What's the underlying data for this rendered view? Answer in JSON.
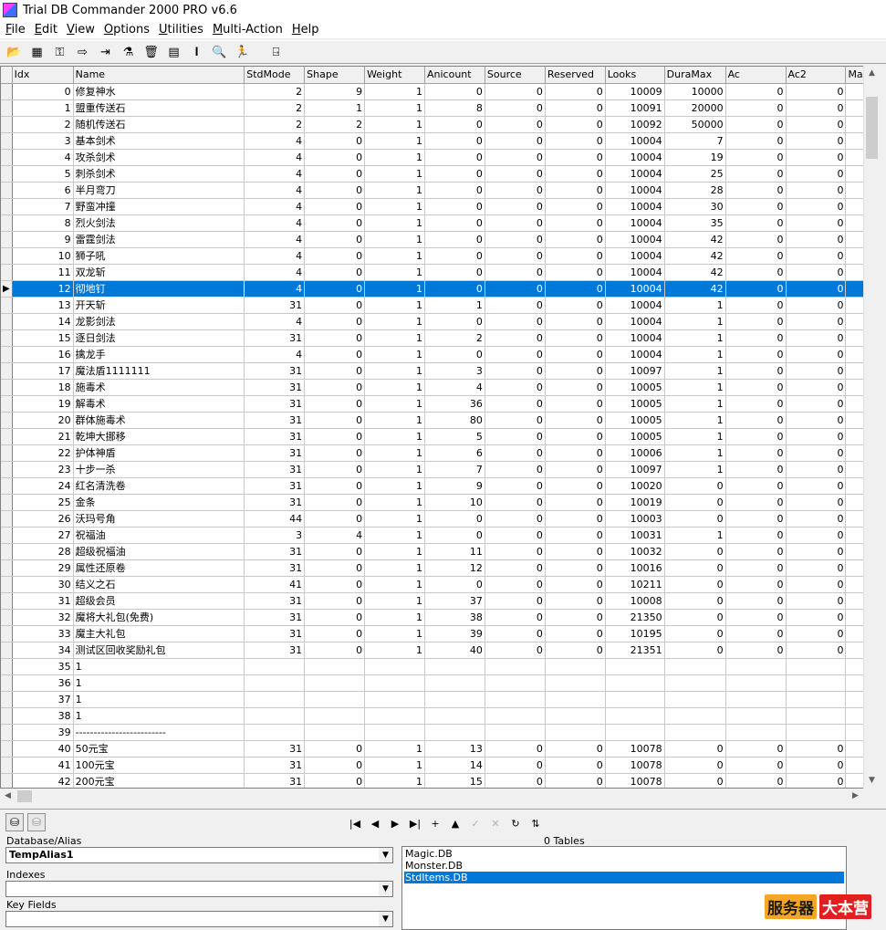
{
  "window": {
    "title": "Trial DB Commander 2000 PRO v6.6"
  },
  "menu": [
    "File",
    "Edit",
    "View",
    "Options",
    "Utilities",
    "Multi-Action",
    "Help"
  ],
  "menu_underline": [
    "F",
    "E",
    "V",
    "O",
    "U",
    "M",
    "H"
  ],
  "toolbar": [
    {
      "icon": "open-folder-icon",
      "glyph": "📂"
    },
    {
      "icon": "grid-view-icon",
      "glyph": "▦"
    },
    {
      "icon": "key-icon",
      "glyph": "⚿"
    },
    {
      "icon": "arrow-right-icon",
      "glyph": "⇨"
    },
    {
      "icon": "export-icon",
      "glyph": "⇥"
    },
    {
      "icon": "filter-icon",
      "glyph": "⚗"
    },
    {
      "icon": "trash-icon",
      "glyph": "🗑"
    },
    {
      "icon": "table-icon",
      "glyph": "▤"
    },
    {
      "icon": "index-icon",
      "glyph": "𝐈"
    },
    {
      "icon": "search-icon",
      "glyph": "🔍"
    },
    {
      "icon": "run-icon",
      "glyph": "🏃"
    },
    {
      "icon": "exit-icon",
      "glyph": "⍈"
    }
  ],
  "grid": {
    "columns": [
      "Idx",
      "Name",
      "StdMode",
      "Shape",
      "Weight",
      "Anicount",
      "Source",
      "Reserved",
      "Looks",
      "DuraMax",
      "Ac",
      "Ac2",
      "Mac"
    ],
    "selected_index": 12,
    "rows": [
      [
        "0",
        "修复神水",
        "2",
        "9",
        "1",
        "0",
        "0",
        "0",
        "10009",
        "10000",
        "0",
        "0"
      ],
      [
        "1",
        "盟重传送石",
        "2",
        "1",
        "1",
        "8",
        "0",
        "0",
        "10091",
        "20000",
        "0",
        "0"
      ],
      [
        "2",
        "随机传送石",
        "2",
        "2",
        "1",
        "0",
        "0",
        "0",
        "10092",
        "50000",
        "0",
        "0"
      ],
      [
        "3",
        "基本剑术",
        "4",
        "0",
        "1",
        "0",
        "0",
        "0",
        "10004",
        "7",
        "0",
        "0"
      ],
      [
        "4",
        "攻杀剑术",
        "4",
        "0",
        "1",
        "0",
        "0",
        "0",
        "10004",
        "19",
        "0",
        "0"
      ],
      [
        "5",
        "刺杀剑术",
        "4",
        "0",
        "1",
        "0",
        "0",
        "0",
        "10004",
        "25",
        "0",
        "0"
      ],
      [
        "6",
        "半月弯刀",
        "4",
        "0",
        "1",
        "0",
        "0",
        "0",
        "10004",
        "28",
        "0",
        "0"
      ],
      [
        "7",
        "野蛮冲撞",
        "4",
        "0",
        "1",
        "0",
        "0",
        "0",
        "10004",
        "30",
        "0",
        "0"
      ],
      [
        "8",
        "烈火剑法",
        "4",
        "0",
        "1",
        "0",
        "0",
        "0",
        "10004",
        "35",
        "0",
        "0"
      ],
      [
        "9",
        "雷霆剑法",
        "4",
        "0",
        "1",
        "0",
        "0",
        "0",
        "10004",
        "42",
        "0",
        "0"
      ],
      [
        "10",
        "狮子吼",
        "4",
        "0",
        "1",
        "0",
        "0",
        "0",
        "10004",
        "42",
        "0",
        "0"
      ],
      [
        "11",
        "双龙斩",
        "4",
        "0",
        "1",
        "0",
        "0",
        "0",
        "10004",
        "42",
        "0",
        "0"
      ],
      [
        "12",
        "彻地钉",
        "4",
        "0",
        "1",
        "0",
        "0",
        "0",
        "10004",
        "42",
        "0",
        "0"
      ],
      [
        "13",
        "开天斩",
        "31",
        "0",
        "1",
        "1",
        "0",
        "0",
        "10004",
        "1",
        "0",
        "0"
      ],
      [
        "14",
        "龙影剑法",
        "4",
        "0",
        "1",
        "0",
        "0",
        "0",
        "10004",
        "1",
        "0",
        "0"
      ],
      [
        "15",
        "逐日剑法",
        "31",
        "0",
        "1",
        "2",
        "0",
        "0",
        "10004",
        "1",
        "0",
        "0"
      ],
      [
        "16",
        "擒龙手",
        "4",
        "0",
        "1",
        "0",
        "0",
        "0",
        "10004",
        "1",
        "0",
        "0"
      ],
      [
        "17",
        "魔法盾1111111",
        "31",
        "0",
        "1",
        "3",
        "0",
        "0",
        "10097",
        "1",
        "0",
        "0"
      ],
      [
        "18",
        "施毒术",
        "31",
        "0",
        "1",
        "4",
        "0",
        "0",
        "10005",
        "1",
        "0",
        "0"
      ],
      [
        "19",
        "解毒术",
        "31",
        "0",
        "1",
        "36",
        "0",
        "0",
        "10005",
        "1",
        "0",
        "0"
      ],
      [
        "20",
        "群体施毒术",
        "31",
        "0",
        "1",
        "80",
        "0",
        "0",
        "10005",
        "1",
        "0",
        "0"
      ],
      [
        "21",
        "乾坤大挪移",
        "31",
        "0",
        "1",
        "5",
        "0",
        "0",
        "10005",
        "1",
        "0",
        "0"
      ],
      [
        "22",
        "护体神盾",
        "31",
        "0",
        "1",
        "6",
        "0",
        "0",
        "10006",
        "1",
        "0",
        "0"
      ],
      [
        "23",
        "十步一杀",
        "31",
        "0",
        "1",
        "7",
        "0",
        "0",
        "10097",
        "1",
        "0",
        "0"
      ],
      [
        "24",
        "红名清洗卷",
        "31",
        "0",
        "1",
        "9",
        "0",
        "0",
        "10020",
        "0",
        "0",
        "0"
      ],
      [
        "25",
        "金条",
        "31",
        "0",
        "1",
        "10",
        "0",
        "0",
        "10019",
        "0",
        "0",
        "0"
      ],
      [
        "26",
        "沃玛号角",
        "44",
        "0",
        "1",
        "0",
        "0",
        "0",
        "10003",
        "0",
        "0",
        "0"
      ],
      [
        "27",
        "祝福油",
        "3",
        "4",
        "1",
        "0",
        "0",
        "0",
        "10031",
        "1",
        "0",
        "0"
      ],
      [
        "28",
        "超级祝福油",
        "31",
        "0",
        "1",
        "11",
        "0",
        "0",
        "10032",
        "0",
        "0",
        "0"
      ],
      [
        "29",
        "属性还原卷",
        "31",
        "0",
        "1",
        "12",
        "0",
        "0",
        "10016",
        "0",
        "0",
        "0"
      ],
      [
        "30",
        "结义之石",
        "41",
        "0",
        "1",
        "0",
        "0",
        "0",
        "10211",
        "0",
        "0",
        "0"
      ],
      [
        "31",
        "超级会员",
        "31",
        "0",
        "1",
        "37",
        "0",
        "0",
        "10008",
        "0",
        "0",
        "0"
      ],
      [
        "32",
        "魔将大礼包(免费)",
        "31",
        "0",
        "1",
        "38",
        "0",
        "0",
        "21350",
        "0",
        "0",
        "0"
      ],
      [
        "33",
        "魔主大礼包",
        "31",
        "0",
        "1",
        "39",
        "0",
        "0",
        "10195",
        "0",
        "0",
        "0"
      ],
      [
        "34",
        "测试区回收奖励礼包",
        "31",
        "0",
        "1",
        "40",
        "0",
        "0",
        "21351",
        "0",
        "0",
        "0"
      ],
      [
        "35",
        "1",
        "",
        "",
        "",
        "",
        "",
        "",
        "",
        "",
        "",
        ""
      ],
      [
        "36",
        "1",
        "",
        "",
        "",
        "",
        "",
        "",
        "",
        "",
        "",
        ""
      ],
      [
        "37",
        "1",
        "",
        "",
        "",
        "",
        "",
        "",
        "",
        "",
        "",
        ""
      ],
      [
        "38",
        "1",
        "",
        "",
        "",
        "",
        "",
        "",
        "",
        "",
        "",
        ""
      ],
      [
        "39",
        "-------------------------",
        "",
        "",
        "",
        "",
        "",
        "",
        "",
        "",
        "",
        ""
      ],
      [
        "40",
        "50元宝",
        "31",
        "0",
        "1",
        "13",
        "0",
        "0",
        "10078",
        "0",
        "0",
        "0"
      ],
      [
        "41",
        "100元宝",
        "31",
        "0",
        "1",
        "14",
        "0",
        "0",
        "10078",
        "0",
        "0",
        "0"
      ],
      [
        "42",
        "200元宝",
        "31",
        "0",
        "1",
        "15",
        "0",
        "0",
        "10078",
        "0",
        "0",
        "0"
      ]
    ]
  },
  "bottom": {
    "database_label": "Database/Alias",
    "database_value": "TempAlias1",
    "indexes_label": "Indexes",
    "indexes_value": "",
    "keyfields_label": "Key Fields",
    "keyfields_value": "",
    "tables_count": "0 Tables",
    "tables": [
      "Magic.DB",
      "Monster.DB",
      "StdItems.DB"
    ],
    "selected_table": "StdItems.DB",
    "nav": [
      {
        "icon": "first-record-icon",
        "glyph": "|◀",
        "enabled": true
      },
      {
        "icon": "prior-record-icon",
        "glyph": "◀",
        "enabled": true
      },
      {
        "icon": "next-record-icon",
        "glyph": "▶",
        "enabled": true
      },
      {
        "icon": "last-record-icon",
        "glyph": "▶|",
        "enabled": true
      },
      {
        "icon": "insert-record-icon",
        "glyph": "+",
        "enabled": true
      },
      {
        "icon": "edit-record-icon",
        "glyph": "▲",
        "enabled": true
      },
      {
        "icon": "post-record-icon",
        "glyph": "✓",
        "enabled": false
      },
      {
        "icon": "cancel-record-icon",
        "glyph": "✕",
        "enabled": false
      },
      {
        "icon": "refresh-icon",
        "glyph": "↻",
        "enabled": true
      },
      {
        "icon": "filter-nav-icon",
        "glyph": "⇅",
        "enabled": true
      }
    ]
  },
  "watermark": {
    "part1": "服务器",
    "part2": "大本营"
  }
}
